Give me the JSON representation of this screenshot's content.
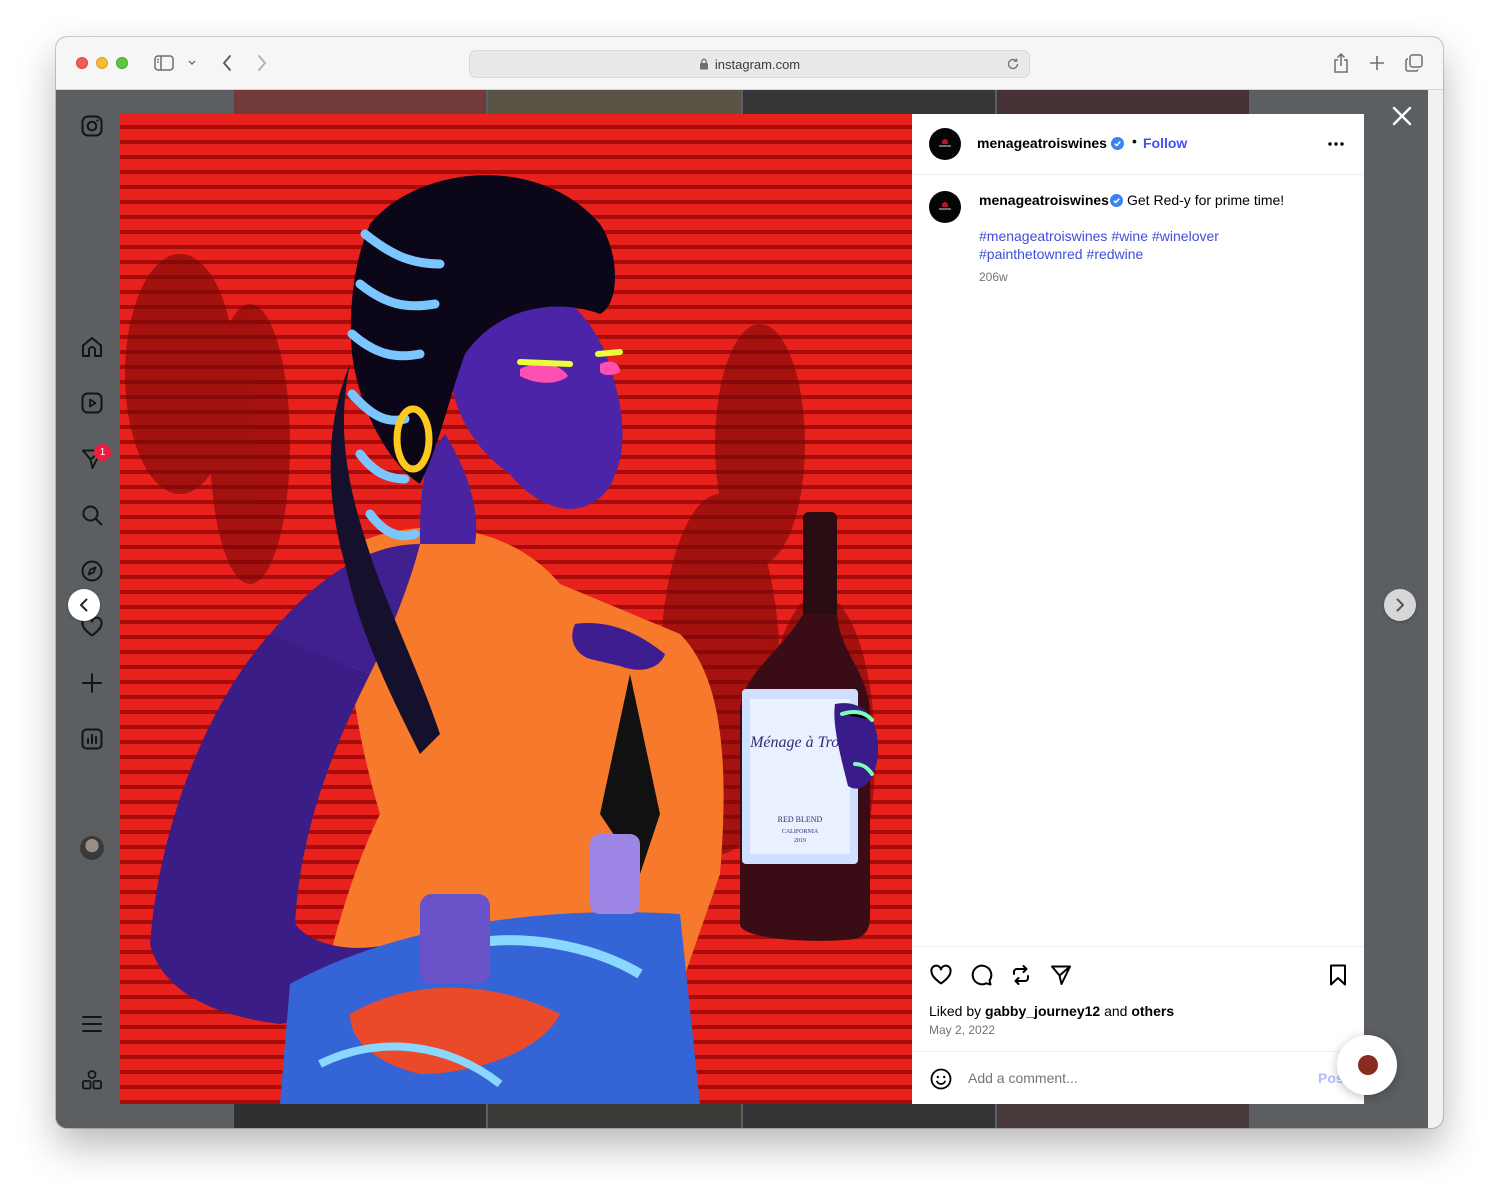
{
  "browser": {
    "url": "instagram.com",
    "tool_icons": [
      "sidebar-icon",
      "chevron-down-icon",
      "back-icon",
      "forward-icon",
      "share-icon",
      "new-tab-icon",
      "tabs-overview-icon"
    ]
  },
  "sidebar": {
    "items": [
      {
        "name": "instagram-logo-icon"
      },
      {
        "name": "home-icon"
      },
      {
        "name": "reels-icon"
      },
      {
        "name": "messages-icon",
        "badge": "1"
      },
      {
        "name": "search-icon"
      },
      {
        "name": "explore-icon"
      },
      {
        "name": "notifications-icon"
      },
      {
        "name": "create-icon"
      },
      {
        "name": "insights-icon"
      },
      {
        "name": "profile-avatar"
      },
      {
        "name": "menu-icon"
      },
      {
        "name": "apps-icon"
      }
    ]
  },
  "post": {
    "username": "menageatroiswines",
    "verified": true,
    "follow_label": "Follow",
    "caption": "Get Red-y for prime time!",
    "hashtags": [
      "#menageatroiswines",
      "#wine",
      "#winelover",
      "#painthetownred",
      "#redwine"
    ],
    "age": "206w",
    "liked_by_prefix": "Liked by",
    "liked_by_user": "gabby_journey12",
    "liked_by_joiner": "and",
    "liked_by_suffix": "others",
    "date": "May 2, 2022",
    "comment_placeholder": "Add a comment...",
    "post_label": "Post",
    "image": {
      "bottle_brand": "Ménage à Trois",
      "bottle_variety": "RED BLEND",
      "bottle_region": "CALIFORNIA",
      "bottle_year": "2019"
    }
  },
  "colors": {
    "link_blue": "#4150f7",
    "hashtag_blue": "#3f4ed9",
    "verified_blue": "#3b82f6",
    "badge_red": "#ee1c40",
    "backdrop": "#5c5f62"
  }
}
